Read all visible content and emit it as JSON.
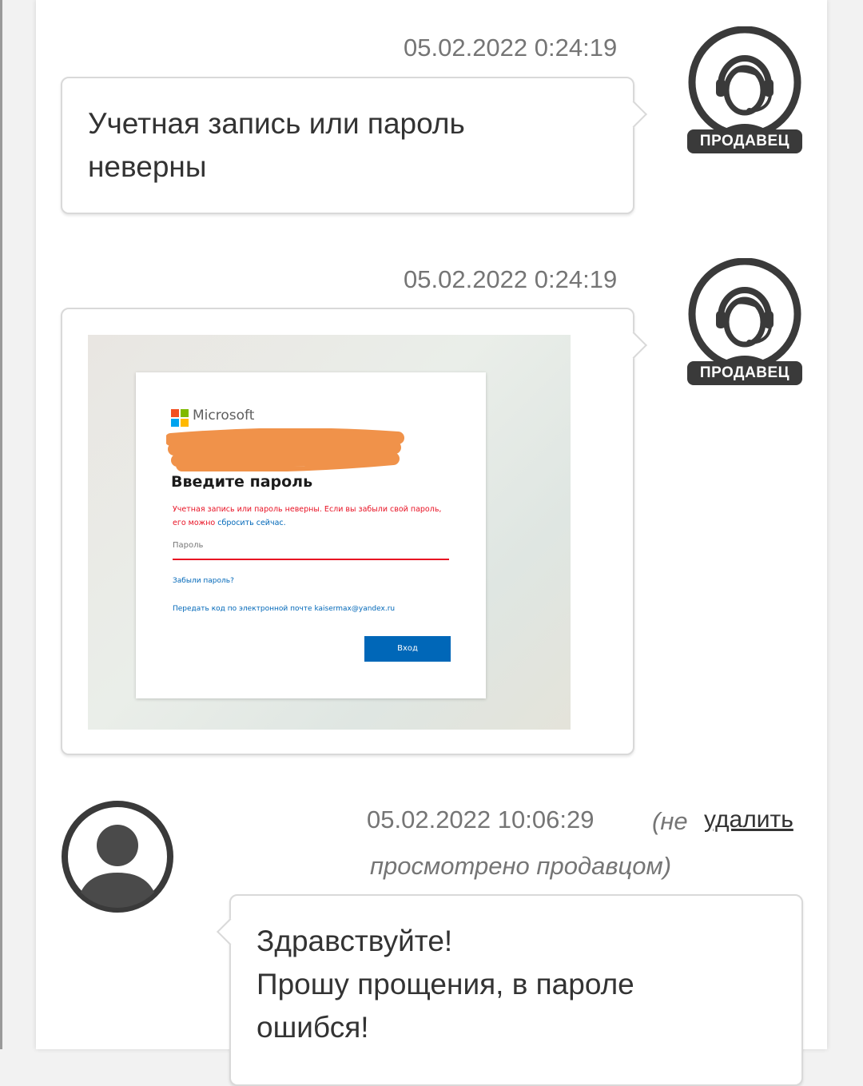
{
  "messages": [
    {
      "timestamp": "05.02.2022 0:24:19",
      "text_lines": [
        "Учетная запись или пароль",
        "неверны"
      ],
      "sender_badge": "ПРОДАВЕЦ"
    },
    {
      "timestamp": "05.02.2022 0:24:19",
      "sender_badge": "ПРОДАВЕЦ",
      "attachment": {
        "brand": "Microsoft",
        "title": "Введите пароль",
        "error_text": "Учетная запись или пароль неверны. Если вы забыли свой пароль, его можно",
        "error_link": "сбросить сейчас.",
        "password_placeholder": "Пароль",
        "forgot_link": "Забыли пароль?",
        "send_code_link": "Передать код по электронной почте kaisermax@yandex.ru",
        "submit_label": "Вход"
      }
    },
    {
      "timestamp": "05.02.2022 10:06:29",
      "status_open": "(не",
      "delete_label": "удалить",
      "status_rest": "просмотрено продавцом)",
      "text_lines": [
        "Здравствуйте!",
        "Прошу прощения, в пароле",
        "ошибся!"
      ]
    }
  ],
  "colors": {
    "accent_microsoft_blue": "#0067b8",
    "error_red": "#e81123",
    "redaction_orange": "#f0924a"
  }
}
